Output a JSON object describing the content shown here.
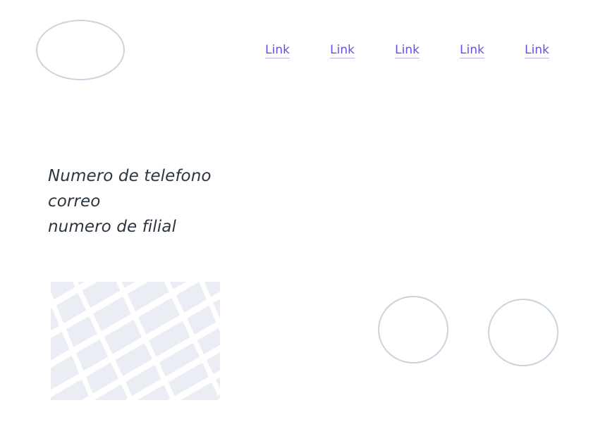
{
  "header": {
    "logo_icon": "logo-placeholder-icon",
    "nav_links": [
      {
        "label": "Link"
      },
      {
        "label": "Link"
      },
      {
        "label": "Link"
      },
      {
        "label": "Link"
      },
      {
        "label": "Link"
      }
    ]
  },
  "contact": {
    "phone": "Numero de telefono",
    "email": "correo",
    "branch": "numero de filial"
  },
  "map": {
    "icon": "map-icon"
  },
  "social": {
    "icons": [
      "social-icon",
      "social-icon"
    ]
  },
  "colors": {
    "link": "#6650e6",
    "text": "#2c3642",
    "outline": "#c8d4df",
    "map_block": "#eaeef4"
  }
}
